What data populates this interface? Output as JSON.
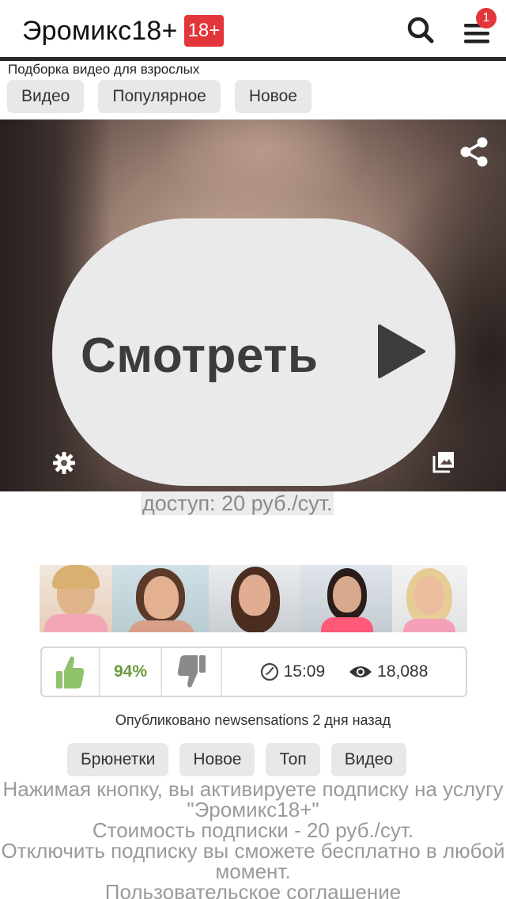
{
  "header": {
    "logo_text": "Эромикс18+",
    "logo_badge": "18+",
    "menu_badge_count": "1"
  },
  "tagline": "Подборка видео для взрослых",
  "nav": [
    {
      "label": "Видео"
    },
    {
      "label": "Популярное"
    },
    {
      "label": "Новое"
    }
  ],
  "player": {
    "watch_label": "Смотреть",
    "price": "доступ: 20 руб./сут."
  },
  "stats": {
    "rating": "94%",
    "duration": "15:09",
    "views": "18,088"
  },
  "published": "Опубликовано newsensations 2 дня назад",
  "tags": [
    {
      "label": "Брюнетки"
    },
    {
      "label": "Новое"
    },
    {
      "label": "Топ"
    },
    {
      "label": "Видео"
    }
  ],
  "terms": {
    "line1": "Нажимая кнопку, вы активируете подписку на услугу \"Эромикс18+\"",
    "line2": "Стоимость подписки - 20 руб./сут.",
    "line3": "Отключить подписку вы сможете бесплатно в любой момент.",
    "link": "Пользовательское соглашение"
  },
  "colors": {
    "accent_red": "#e3363a",
    "rating_green": "#6a9a3a",
    "button_gray": "#e8e8e8"
  }
}
